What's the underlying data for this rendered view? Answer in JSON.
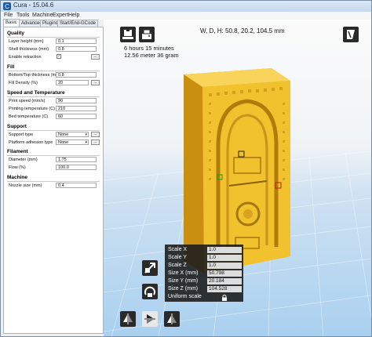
{
  "window": {
    "title": "Cura - 15.04.6"
  },
  "menu": [
    "File",
    "Tools",
    "Machine",
    "Expert",
    "Help"
  ],
  "tabs": [
    "Basic",
    "Advanced",
    "Plugins",
    "Start/End-GCode"
  ],
  "sections": {
    "quality": {
      "title": "Quality",
      "layer_height_label": "Layer height (mm)",
      "layer_height": "0.1",
      "shell_thickness_label": "Shell thickness (mm)",
      "shell_thickness": "0.8",
      "retraction_label": "Enable retraction",
      "retraction_checked": "✓"
    },
    "fill": {
      "title": "Fill",
      "bottom_top_label": "Bottom/Top thickness (mm)",
      "bottom_top": "0.8",
      "fill_density_label": "Fill Density (%)",
      "fill_density": "20"
    },
    "speed": {
      "title": "Speed and Temperature",
      "print_speed_label": "Print speed (mm/s)",
      "print_speed": "90",
      "print_temp_label": "Printing temperature (C)",
      "print_temp": "210",
      "bed_temp_label": "Bed temperature (C)",
      "bed_temp": "60"
    },
    "support": {
      "title": "Support",
      "support_type_label": "Support type",
      "support_type": "None",
      "adhesion_label": "Platform adhesion type",
      "adhesion": "None"
    },
    "filament": {
      "title": "Filament",
      "diameter_label": "Diameter (mm)",
      "diameter": "1.75",
      "flow_label": "Flow (%)",
      "flow": "100.0"
    },
    "machine": {
      "title": "Machine",
      "nozzle_label": "Nozzle size (mm)",
      "nozzle": "0.4"
    }
  },
  "viewport": {
    "dims": "W, D, H: 50.8, 20.2, 104.5 mm",
    "print_time": "6 hours 15 minutes",
    "filament_usage": "12.56 meter 36 gram"
  },
  "scale_panel": {
    "scale_x_label": "Scale X",
    "scale_x": "1.0",
    "scale_y_label": "Scale Y",
    "scale_y": "1.0",
    "scale_z_label": "Scale Z",
    "scale_z": "1.0",
    "size_x_label": "Size X (mm)",
    "size_x": "50.798",
    "size_y_label": "Size Y (mm)",
    "size_y": "20.184",
    "size_z_label": "Size Z (mm)",
    "size_z": "104.528",
    "uniform_label": "Uniform scale"
  },
  "colors": {
    "model": "#f2c12e",
    "bed": "#a9d0ef",
    "panel_bg": "#2a2a2a"
  }
}
